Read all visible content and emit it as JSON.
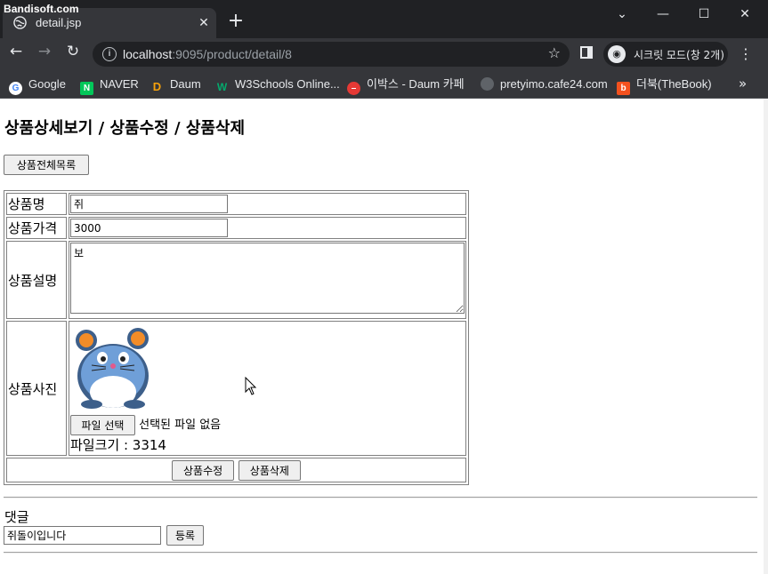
{
  "watermark": "Bandisoft.com",
  "browser": {
    "tab_title": "detail.jsp",
    "url_host": "localhost",
    "url_rest": ":9095/product/detail/8",
    "incognito_label": "시크릿 모드(창 2개)",
    "bookmarks": [
      {
        "label": "Google",
        "icon": "google-icon",
        "color": "#4285f4"
      },
      {
        "label": "NAVER",
        "icon": "naver-icon",
        "color": "#03c75a"
      },
      {
        "label": "Daum",
        "icon": "daum-icon",
        "color": "#3b82f6"
      },
      {
        "label": "W3Schools Online...",
        "icon": "w3schools-icon",
        "color": "#04aa6d"
      },
      {
        "label": "이박스 - Daum 카페",
        "icon": "daum-cafe-icon",
        "color": "#e53935"
      },
      {
        "label": "pretyimo.cafe24.com",
        "icon": "globe-icon",
        "color": "#5f6368"
      },
      {
        "label": "더북(TheBook)",
        "icon": "thebook-icon",
        "color": "#f4511e"
      }
    ]
  },
  "page": {
    "heading": "상품상세보기 / 상품수정 / 상품삭제",
    "list_button": "상품전체목록",
    "form": {
      "name_label": "상품명",
      "name_value": "쥐",
      "price_label": "상품가격",
      "price_value": "3000",
      "desc_label": "상품설명",
      "desc_value": "보",
      "photo_label": "상품사진",
      "file_button": "파일 선택",
      "file_status": "선택된 파일 없음",
      "file_size_label": "파일크기 : 3314",
      "update_button": "상품수정",
      "delete_button": "상품삭제"
    },
    "comment": {
      "label": "댓글",
      "input_value": "쥐돌이입니다",
      "submit_button": "등록"
    }
  },
  "colors": {
    "chrome_dark": "#202124",
    "chrome_mid": "#35363a",
    "mouse_body": "#6f9fd8",
    "mouse_ear": "#f28c28"
  }
}
